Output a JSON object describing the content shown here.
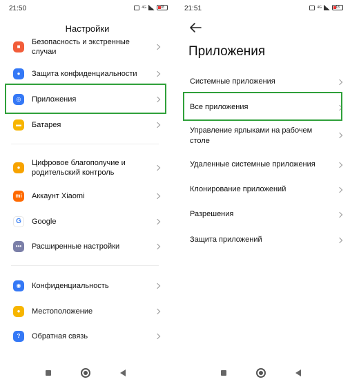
{
  "left_screen": {
    "status_time": "21:50",
    "battery": "18",
    "network": "4G",
    "title": "Настройки",
    "items": [
      {
        "label": "Безопасность и экстренные случаи",
        "icon": "shield-icon",
        "color": "#f25d3a"
      },
      {
        "label": "Защита конфиденциальности",
        "icon": "privacy-protection-icon",
        "color": "#3478f6"
      },
      {
        "label": "Приложения",
        "icon": "apps-icon",
        "color": "#3478f6"
      },
      {
        "label": "Батарея",
        "icon": "battery-icon",
        "color": "#f7b500"
      },
      {
        "label": "Цифровое благополучие и родительский контроль",
        "icon": "wellbeing-icon",
        "color": "#f7a300"
      },
      {
        "label": "Аккаунт Xiaomi",
        "icon": "xiaomi-icon",
        "color": "#ff6a00"
      },
      {
        "label": "Google",
        "icon": "google-icon",
        "color": "#ffffff"
      },
      {
        "label": "Расширенные настройки",
        "icon": "more-icon",
        "color": "#7b7fa8"
      },
      {
        "label": "Конфиденциальность",
        "icon": "eye-icon",
        "color": "#3478f6"
      },
      {
        "label": "Местоположение",
        "icon": "location-pin-icon",
        "color": "#f7b500"
      },
      {
        "label": "Обратная связь",
        "icon": "feedback-icon",
        "color": "#3478f6"
      }
    ]
  },
  "right_screen": {
    "status_time": "21:51",
    "battery": "18",
    "network": "4G",
    "title": "Приложения",
    "items": [
      {
        "label": "Системные приложения"
      },
      {
        "label": "Все приложения"
      },
      {
        "label": "Управление ярлыками на рабочем столе"
      },
      {
        "label": "Удаленные системные приложения"
      },
      {
        "label": "Клонирование приложений"
      },
      {
        "label": "Разрешения"
      },
      {
        "label": "Защита приложений"
      }
    ]
  },
  "highlight_color": "#2fa03a"
}
